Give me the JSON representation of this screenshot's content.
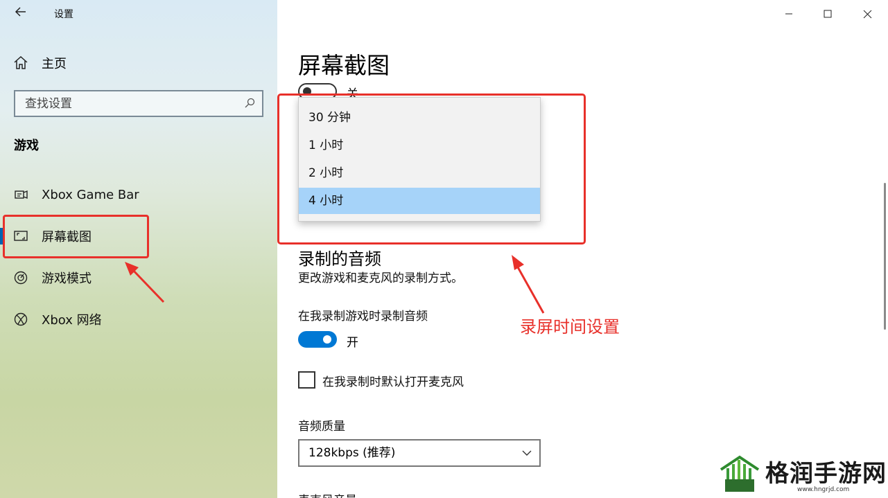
{
  "window": {
    "app_title": "设置",
    "back_icon": "back-arrow-icon",
    "controls": [
      "minimize-icon",
      "maximize-icon",
      "close-icon"
    ]
  },
  "sidebar": {
    "home_label": "主页",
    "search_placeholder": "查找设置",
    "section_label": "游戏",
    "items": [
      {
        "label": "Xbox Game Bar",
        "icon": "game-bar-icon"
      },
      {
        "label": "屏幕截图",
        "icon": "captures-icon",
        "active": true
      },
      {
        "label": "游戏模式",
        "icon": "game-mode-icon"
      },
      {
        "label": "Xbox 网络",
        "icon": "xbox-icon"
      }
    ]
  },
  "main": {
    "page_title": "屏幕截图",
    "toggle_top_label": "关",
    "dropdown_options": [
      {
        "label": "30 分钟"
      },
      {
        "label": "1 小时"
      },
      {
        "label": "2 小时"
      },
      {
        "label": "4 小时",
        "selected": true
      }
    ],
    "audio_section_title": "录制的音频",
    "audio_section_desc": "更改游戏和麦克风的录制方式。",
    "record_audio_label": "在我录制游戏时录制音频",
    "record_audio_toggle_label": "开",
    "mic_checkbox_label": "在我录制时默认打开麦克风",
    "audio_quality_label": "音频质量",
    "audio_quality_value": "128kbps (推荐)",
    "cut_off_label": "麦克风音量"
  },
  "annotation": {
    "text": "录屏时间设置",
    "color": "#e8302a"
  },
  "watermark": {
    "name": "格润手游网",
    "url": "www.hngrjd.com"
  },
  "colors": {
    "accent": "#0078d4",
    "selected_option": "#a6d3f9",
    "annotation_red": "#e8302a"
  }
}
